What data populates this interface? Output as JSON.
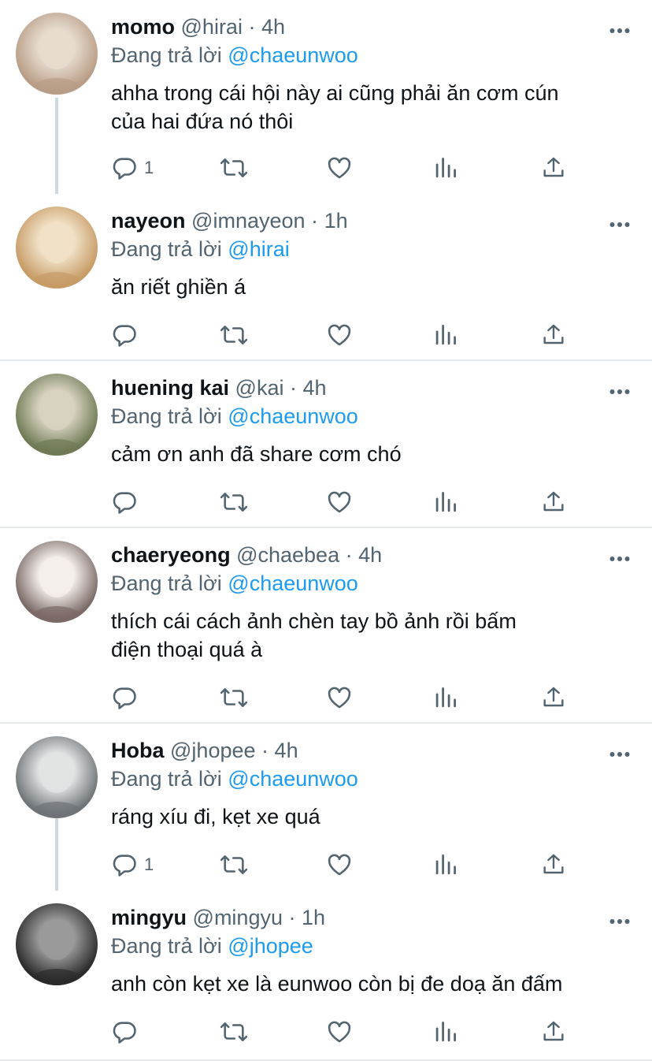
{
  "ui": {
    "reply_prefix": "Đang trả lời",
    "separator": "·",
    "icons": {
      "reply": "reply-icon",
      "retweet": "retweet-icon",
      "like": "heart-icon",
      "analytics": "analytics-icon",
      "share": "share-icon",
      "more": "more-icon"
    },
    "colors": {
      "text": "#0f1419",
      "secondary": "#536471",
      "mention": "#1d9bf0",
      "divider": "#e6e9eb",
      "thread_line": "#cfd9de"
    }
  },
  "tweets": [
    {
      "name": "momo",
      "handle": "@hirai",
      "time": "4h",
      "reply_to": "@chaeunwoo",
      "text": "ahha trong cái hội này ai cũng phải ăn cơm cún\ncủa hai đứa nó thôi",
      "reply_count": "1"
    },
    {
      "name": "nayeon",
      "handle": "@imnayeon",
      "time": "1h",
      "reply_to": "@hirai",
      "text": "ăn riết ghiền á",
      "reply_count": ""
    },
    {
      "name": "huening kai",
      "handle": "@kai",
      "time": "4h",
      "reply_to": "@chaeunwoo",
      "text": "cảm ơn anh đã share cơm chó",
      "reply_count": ""
    },
    {
      "name": "chaeryeong",
      "handle": "@chaebea",
      "time": "4h",
      "reply_to": "@chaeunwoo",
      "text": "thích cái cách ảnh chèn tay bồ ảnh rồi bấm\nđiện thoại quá à",
      "reply_count": ""
    },
    {
      "name": "Hoba",
      "handle": "@jhopee",
      "time": "4h",
      "reply_to": "@chaeunwoo",
      "text": "ráng xíu đi, kẹt xe quá",
      "reply_count": "1"
    },
    {
      "name": "mingyu",
      "handle": "@mingyu",
      "time": "1h",
      "reply_to": "@jhopee",
      "text": "anh còn kẹt xe là eunwoo còn bị đe doạ ăn đấm",
      "reply_count": ""
    }
  ]
}
